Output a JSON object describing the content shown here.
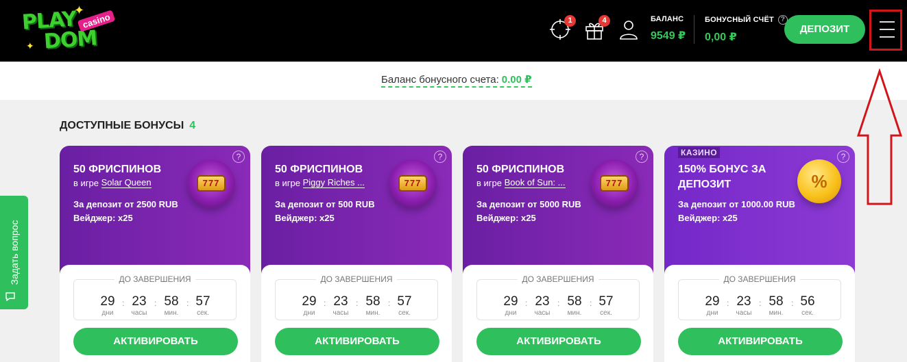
{
  "header": {
    "logo": {
      "line1": "PLAY",
      "line2": "DOM",
      "badge": "casino"
    },
    "missions_badge": "1",
    "gifts_badge": "4",
    "balance": {
      "label": "БАЛАНС",
      "value": "9549 ₽"
    },
    "bonus_account": {
      "label": "БОНУСНЫЙ СЧЁТ",
      "value": "0,00 ₽",
      "help_icon": "?"
    },
    "deposit_button": "ДЕПОЗИТ",
    "icons": [
      "target-icon",
      "gift-icon",
      "user-icon",
      "hamburger-menu-icon"
    ]
  },
  "bonus_bar": {
    "label": "Баланс бонусного счета:",
    "value": "0.00 ₽"
  },
  "section": {
    "title": "ДОСТУПНЫЕ БОНУСЫ",
    "count": "4"
  },
  "side_tab": {
    "label": "Задать вопрос"
  },
  "timer_labels": {
    "heading": "ДО ЗАВЕРШЕНИЯ",
    "days": "дни",
    "hours": "часы",
    "minutes": "мин.",
    "seconds": "сек."
  },
  "cards": [
    {
      "tag": "",
      "title": "50 ФРИСПИНОВ",
      "game_prefix": "в игре",
      "game": "Solar Queen",
      "deposit": "За депозит от 2500 RUB",
      "wager": "Вейджер: x25",
      "image": "slot-777",
      "days": "29",
      "hours": "23",
      "minutes": "58",
      "seconds": "57",
      "button": "АКТИВИРОВАТЬ",
      "help": "?"
    },
    {
      "tag": "",
      "title": "50 ФРИСПИНОВ",
      "game_prefix": "в игре",
      "game": "Piggy Riches ...",
      "deposit": "За депозит от 500 RUB",
      "wager": "Вейджер: x25",
      "image": "slot-777",
      "days": "29",
      "hours": "23",
      "minutes": "58",
      "seconds": "57",
      "button": "АКТИВИРОВАТЬ",
      "help": "?"
    },
    {
      "tag": "",
      "title": "50 ФРИСПИНОВ",
      "game_prefix": "в игре",
      "game": "Book of Sun: ...",
      "deposit": "За депозит от 5000 RUB",
      "wager": "Вейджер: x25",
      "image": "slot-777",
      "days": "29",
      "hours": "23",
      "minutes": "58",
      "seconds": "57",
      "button": "АКТИВИРОВАТЬ",
      "help": "?"
    },
    {
      "tag": "КАЗИНО",
      "title": "150% БОНУС ЗА ДЕПОЗИТ",
      "game_prefix": "",
      "game": "",
      "deposit": "За депозит от 1000.00 RUB",
      "wager": "Вейджер: x25",
      "image": "coin-percent",
      "days": "29",
      "hours": "23",
      "minutes": "58",
      "seconds": "56",
      "button": "АКТИВИРОВАТЬ",
      "help": "?"
    }
  ],
  "colors": {
    "accent_green": "#2fbf5c",
    "card_purple": "#7a24ad",
    "header_bg": "#000000",
    "annotation_red": "#d0161b"
  }
}
